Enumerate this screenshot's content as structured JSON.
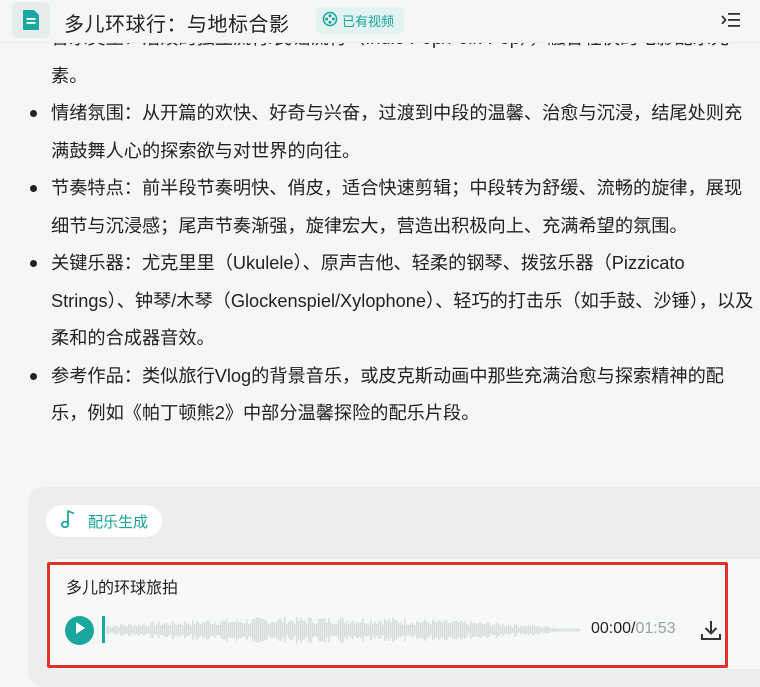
{
  "header": {
    "icon": "document-icon",
    "title": "多儿环球行：与地标合影",
    "badge_icon": "video-reel-icon",
    "badge_label": "已有视频",
    "menu_icon": "list-collapse-icon",
    "accent": "#15a39a"
  },
  "content": {
    "bullets": [
      "音乐类型：活泼的独立流行/民谣流行（Indie Pop/Folk-Pop），融合轻快的电影配乐元素。",
      "情绪氛围：从开篇的欢快、好奇与兴奋，过渡到中段的温馨、治愈与沉浸，结尾处则充满鼓舞人心的探索欲与对世界的向往。",
      "节奏特点：前半段节奏明快、俏皮，适合快速剪辑；中段转为舒缓、流畅的旋律，展现细节与沉浸感；尾声节奏渐强，旋律宏大，营造出积极向上、充满希望的氛围。",
      "关键乐器：尤克里里（Ukulele）、原声吉他、轻柔的钢琴、拨弦乐器（Pizzicato Strings）、钟琴/木琴（Glockenspiel/Xylophone）、轻巧的打击乐（如手鼓、沙锤），以及柔和的合成器音效。",
      "参考作品：类似旅行Vlog的背景音乐，或皮克斯动画中那些充满治愈与探索精神的配乐，例如《帕丁顿熊2》中部分温馨探险的配乐片段。"
    ]
  },
  "music": {
    "tag_icon": "music-note-icon",
    "tag_label": "配乐生成",
    "track_name": "多儿的环球旅拍",
    "current_time": "00:00",
    "separator": "/",
    "total_time": "01:53",
    "progress": 0,
    "play_icon": "play-icon",
    "download_icon": "download-icon",
    "highlight_color": "#e0302a"
  }
}
